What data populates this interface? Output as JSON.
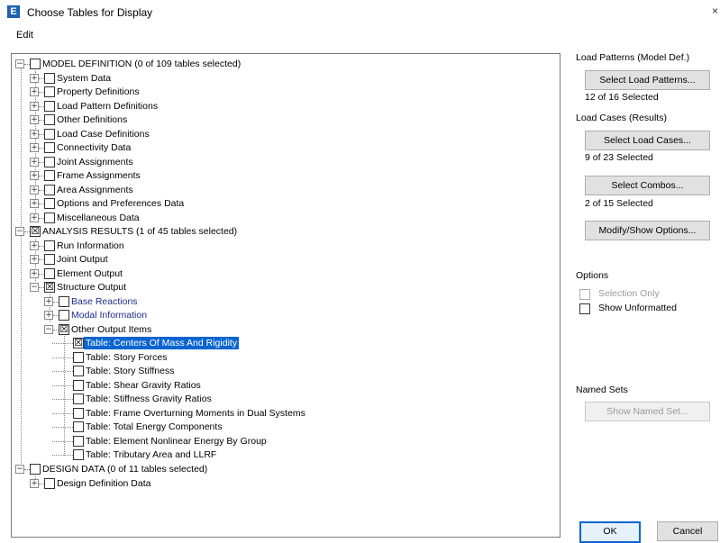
{
  "window": {
    "title": "Choose Tables for Display",
    "app_icon": "E",
    "close": "×"
  },
  "menu": {
    "edit": "Edit"
  },
  "tree": {
    "model_definition": {
      "label": "MODEL DEFINITION  (0 of 109 tables selected)",
      "children": [
        "System Data",
        "Property Definitions",
        "Load Pattern Definitions",
        "Other Definitions",
        "Load Case Definitions",
        "Connectivity Data",
        "Joint Assignments",
        "Frame Assignments",
        "Area Assignments",
        "Options and Preferences Data",
        "Miscellaneous Data"
      ]
    },
    "analysis_results": {
      "label": "ANALYSIS RESULTS  (1 of 45 tables selected)",
      "children": [
        "Run Information",
        "Joint Output",
        "Element Output",
        "Structure Output"
      ],
      "structure_children": [
        "Base Reactions",
        "Modal Information",
        "Other Output Items"
      ],
      "tables": [
        "Table:  Centers Of Mass And Rigidity",
        "Table:  Story Forces",
        "Table:  Story Stiffness",
        "Table:  Shear Gravity Ratios",
        "Table:  Stiffness Gravity Ratios",
        "Table:  Frame Overturning Moments in Dual Systems",
        "Table:  Total Energy Components",
        "Table:  Element Nonlinear Energy By Group",
        "Table:  Tributary Area and LLRF"
      ]
    },
    "design_data": {
      "label": "DESIGN DATA  (0 of 11 tables selected)",
      "children": [
        "Design Definition Data"
      ]
    },
    "checked_glyph": "☒"
  },
  "side": {
    "load_patterns_heading": "Load Patterns (Model Def.)",
    "select_load_patterns": "Select Load Patterns...",
    "load_patterns_status": "12 of 16 Selected",
    "load_cases_heading": "Load Cases (Results)",
    "select_load_cases": "Select Load Cases...",
    "load_cases_status": "9 of 23 Selected",
    "select_combos": "Select Combos...",
    "combos_status": "2 of 15 Selected",
    "modify_show_options": "Modify/Show Options...",
    "options_heading": "Options",
    "selection_only": "Selection Only",
    "show_unformatted": "Show Unformatted",
    "named_sets_heading": "Named Sets",
    "show_named_set": "Show Named Set...",
    "ok": "OK",
    "cancel": "Cancel"
  }
}
